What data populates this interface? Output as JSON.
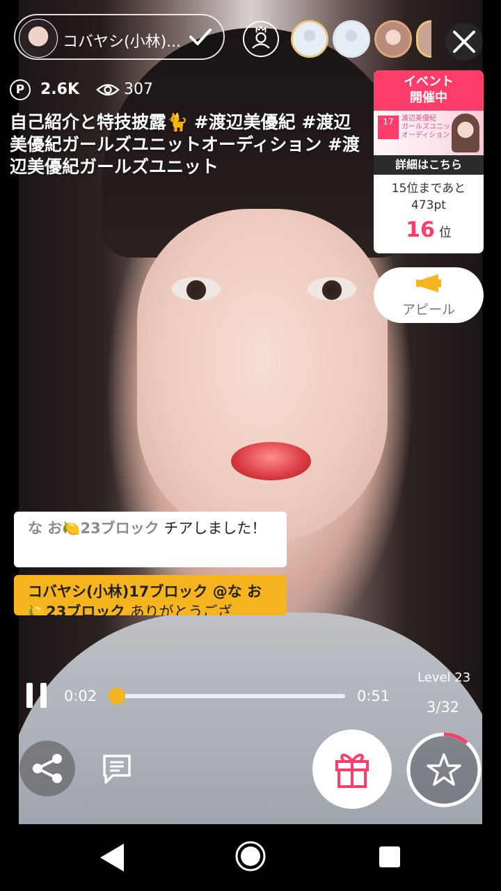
{
  "host": {
    "name": "コバヤシ(小林)..."
  },
  "stats": {
    "points_symbol": "P",
    "points": "2.6K",
    "views": "307"
  },
  "stream": {
    "title_text": "自己紹介と特技披露🐈 #渡辺美優紀 #渡辺美優紀ガールズユニットオーディション #渡辺美優紀ガールズユニット"
  },
  "event": {
    "header": "イベント\n開催中",
    "banner_logo": "17",
    "banner_line1": "渡辺美優紀",
    "banner_line2": "ガールズユニット",
    "banner_line3": "オーディション",
    "details": "詳細はこちら",
    "remaining_line1": "15位まであと",
    "remaining_line2": "473pt",
    "rank": "16",
    "rank_unit": "位"
  },
  "appeal": {
    "label": "アピール"
  },
  "comments": [
    {
      "user": "な お🍋23ブロック",
      "message": "チアしました！"
    },
    {
      "user": "コバヤシ(小林)17ブロック @な お🍋23ブロック",
      "message": "ありがとうござ"
    }
  ],
  "player": {
    "current_time": "0:02",
    "end_time": "0:51",
    "progress": 0.04
  },
  "level": {
    "label": "Level 23",
    "count": "3/32"
  },
  "colors": {
    "accent_pink": "#ff3d6b",
    "accent_yellow": "#f6b51f"
  },
  "icons": [
    "check-icon",
    "crown-icon",
    "close-icon",
    "eye-icon",
    "megaphone-icon",
    "pause-icon",
    "share-icon",
    "chat-icon",
    "gift-icon",
    "star-icon",
    "back-icon",
    "home-icon",
    "recent-apps-icon"
  ]
}
